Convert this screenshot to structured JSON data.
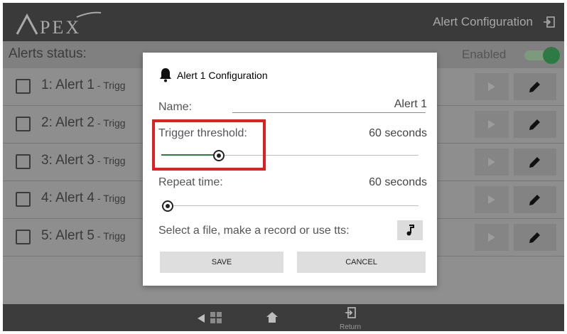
{
  "app": {
    "logo_text": "APEX",
    "title": "Alert Configuration",
    "exit_icon": "logout-icon"
  },
  "status": {
    "label": "Alerts status:",
    "enabled_label": "Enabled",
    "enabled": true
  },
  "alerts": [
    {
      "label": "1: Alert 1",
      "sub": " - Trigg"
    },
    {
      "label": "2: Alert 2",
      "sub": " - Trigg"
    },
    {
      "label": "3: Alert 3",
      "sub": " - Trigg"
    },
    {
      "label": "4: Alert 4",
      "sub": " - Trigg"
    },
    {
      "label": "5: Alert 5",
      "sub": " - Trigg"
    }
  ],
  "dialog": {
    "title": "Alert 1 Configuration",
    "name_label": "Name:",
    "name_value": "Alert 1",
    "trigger_label": "Trigger threshold:",
    "trigger_value": "60 seconds",
    "trigger_fraction": 0.22,
    "repeat_label": "Repeat time:",
    "repeat_value": "60 seconds",
    "repeat_fraction": 0.0,
    "file_label": "Select a file, make a record or use tts:",
    "save_label": "SAVE",
    "cancel_label": "CANCEL"
  },
  "bottom": {
    "return_label": "Return"
  },
  "colors": {
    "accent_green": "#2e7a45",
    "highlight_red": "#e0201f"
  }
}
